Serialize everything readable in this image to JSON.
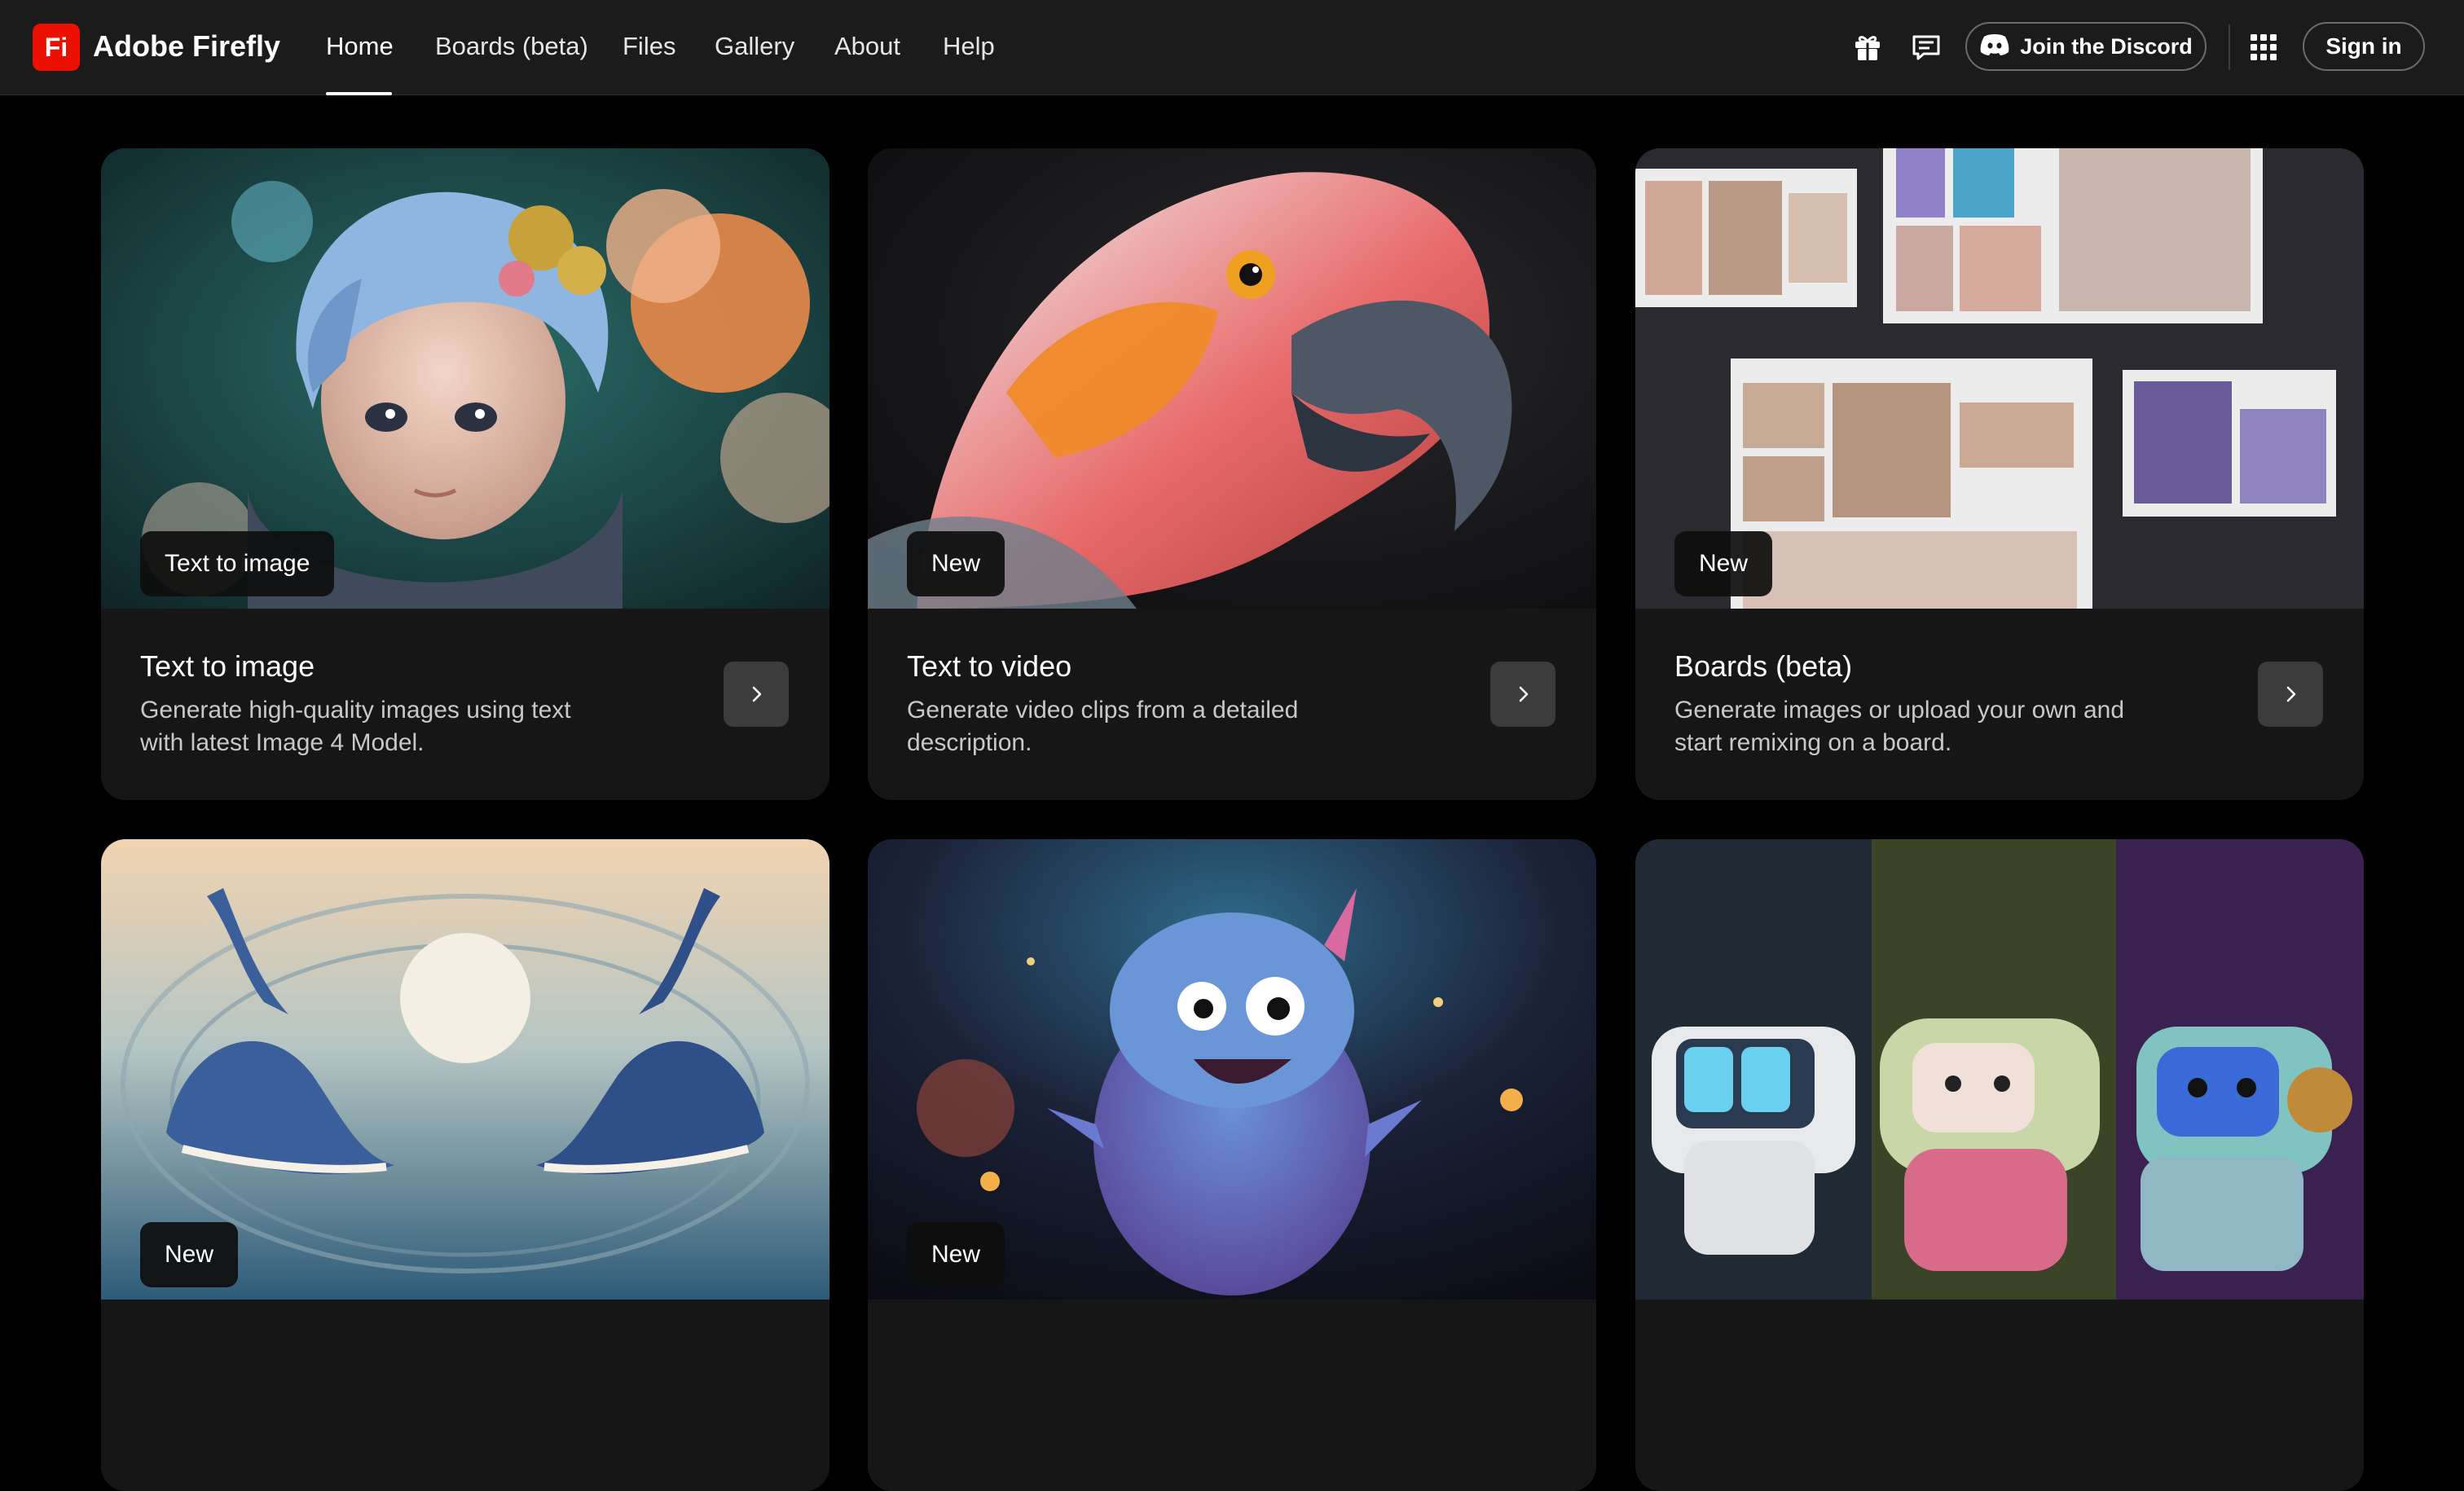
{
  "header": {
    "logo_text": "Fi",
    "brand": "Adobe Firefly",
    "nav": [
      "Home",
      "Boards (beta)",
      "Files",
      "Gallery",
      "About",
      "Help"
    ],
    "active_nav": "Home",
    "discord_label": "Join the Discord",
    "signin_label": "Sign in",
    "icons": [
      "gift-icon",
      "chat-icon",
      "discord-icon",
      "apps-grid-icon"
    ]
  },
  "cards": [
    {
      "badge": "Text to image",
      "title": "Text to image",
      "description": "Generate high-quality images using text with latest Image 4 Model.",
      "image": "blue-haired-child-with-flowers"
    },
    {
      "badge": "New",
      "title": "Text to video",
      "description": "Generate video clips from a detailed description.",
      "image": "parrot-closeup"
    },
    {
      "badge": "New",
      "title": "Boards (beta)",
      "description": "Generate images or upload your own and start remixing on a board.",
      "image": "moodboard-collage"
    },
    {
      "badge": "New",
      "image": "two-whales-moon"
    },
    {
      "badge": "New",
      "image": "fluffy-blue-monster-forest"
    },
    {
      "image": "three-knitted-robots"
    }
  ],
  "colors": {
    "brand_red": "#eb1000",
    "topbar_bg": "#1b1b1b",
    "card_bg": "#161616",
    "page_bg": "#000000"
  }
}
